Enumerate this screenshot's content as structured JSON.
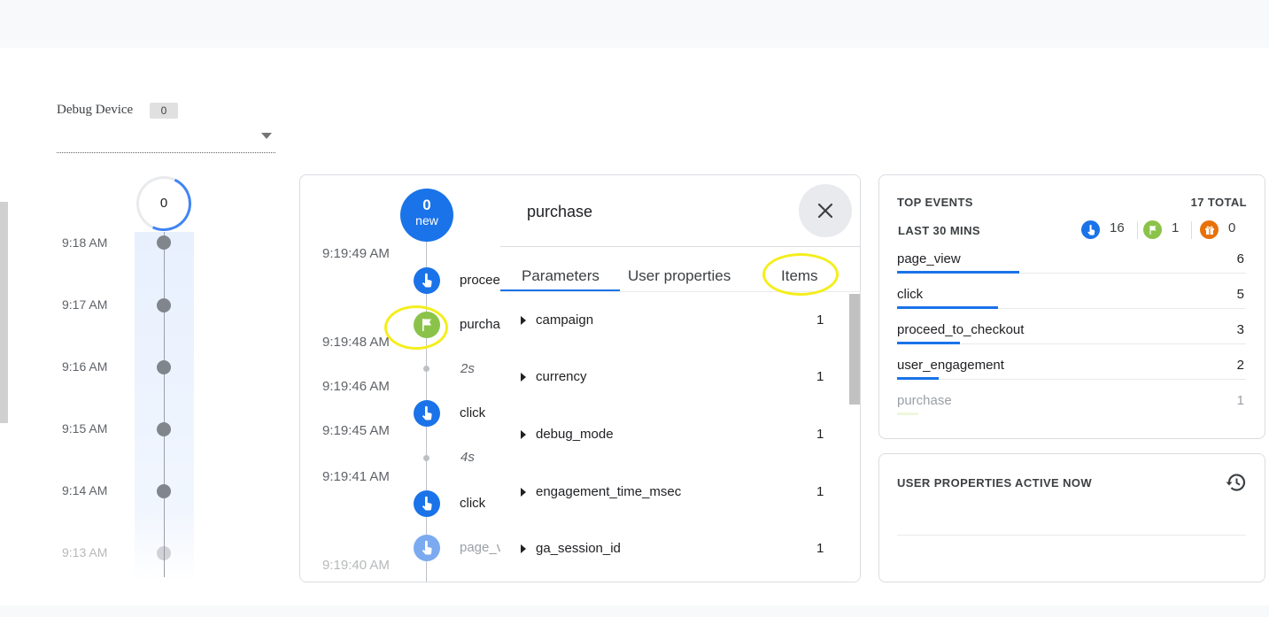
{
  "debug_device": {
    "label": "Debug Device",
    "count": "0"
  },
  "minutes_stream": {
    "current_count": "0",
    "times": [
      "9:18 AM",
      "9:17 AM",
      "9:16 AM",
      "9:15 AM",
      "9:14 AM",
      "9:13 AM"
    ]
  },
  "seconds_stream": {
    "new_count": "0",
    "new_label": "new",
    "times": [
      "9:19:49 AM",
      "9:19:48 AM",
      "9:19:46 AM",
      "9:19:45 AM",
      "9:19:41 AM",
      "9:19:40 AM"
    ],
    "events": [
      {
        "name": "procee",
        "icon": "touch-icon"
      },
      {
        "name": "purcha",
        "icon": "flag-icon"
      },
      {
        "name": "click",
        "icon": "touch-icon"
      },
      {
        "name": "click",
        "icon": "touch-icon"
      },
      {
        "name": "page_v",
        "icon": "touch-icon"
      }
    ],
    "gaps": [
      "2s",
      "4s"
    ]
  },
  "event_detail": {
    "title": "purchase",
    "tabs": [
      "Parameters",
      "User properties",
      "Items"
    ],
    "active_tab": "Parameters",
    "params": [
      {
        "name": "campaign",
        "count": "1"
      },
      {
        "name": "currency",
        "count": "1"
      },
      {
        "name": "debug_mode",
        "count": "1"
      },
      {
        "name": "engagement_time_msec",
        "count": "1"
      },
      {
        "name": "ga_session_id",
        "count": "1"
      }
    ]
  },
  "top_events": {
    "heading": "TOP EVENTS",
    "total": "17 TOTAL",
    "range": "LAST 30 MINS",
    "stats": [
      {
        "icon": "touch-icon",
        "color": "#1a73e8",
        "count": "16"
      },
      {
        "icon": "flag-icon",
        "color": "#8bc34a",
        "count": "1"
      },
      {
        "icon": "gift-icon",
        "color": "#e8710a",
        "count": "0"
      }
    ],
    "rows": [
      {
        "name": "page_view",
        "count": "6",
        "share": 0.35
      },
      {
        "name": "click",
        "count": "5",
        "share": 0.29
      },
      {
        "name": "proceed_to_checkout",
        "count": "3",
        "share": 0.18
      },
      {
        "name": "user_engagement",
        "count": "2",
        "share": 0.12
      },
      {
        "name": "purchase",
        "count": "1",
        "share": 0.06
      }
    ]
  },
  "user_properties": {
    "heading": "USER PROPERTIES ACTIVE NOW"
  },
  "colors": {
    "accent": "#1a73e8",
    "conversion": "#8bc34a",
    "error": "#e8710a",
    "highlight": "#f4ee1c"
  }
}
